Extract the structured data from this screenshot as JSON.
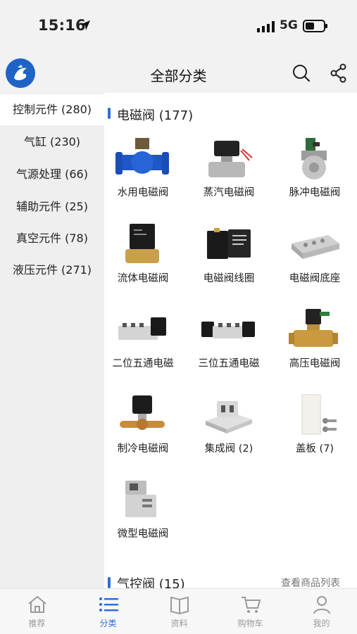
{
  "status_bar": {
    "time": "15:16",
    "network": "5G"
  },
  "header": {
    "title": "全部分类"
  },
  "sidebar": {
    "items": [
      {
        "label": "控制元件 (280)",
        "active": true
      },
      {
        "label": "气缸 (230)",
        "active": false
      },
      {
        "label": "气源处理 (66)",
        "active": false
      },
      {
        "label": "辅助元件 (25)",
        "active": false
      },
      {
        "label": "真空元件 (78)",
        "active": false
      },
      {
        "label": "液压元件 (271)",
        "active": false
      }
    ]
  },
  "main": {
    "sections": [
      {
        "title": "电磁阀 (177)",
        "items": [
          {
            "label": "水用电磁阀",
            "icon": "water-solenoid-valve-icon"
          },
          {
            "label": "蒸汽电磁阀",
            "icon": "steam-solenoid-valve-icon"
          },
          {
            "label": "脉冲电磁阀",
            "icon": "pulse-solenoid-valve-icon"
          },
          {
            "label": "流体电磁阀",
            "icon": "fluid-solenoid-valve-icon"
          },
          {
            "label": "电磁阀线圈",
            "icon": "solenoid-coil-icon"
          },
          {
            "label": "电磁阀底座",
            "icon": "valve-base-icon"
          },
          {
            "label": "二位五通电磁",
            "icon": "two-position-valve-icon"
          },
          {
            "label": "三位五通电磁",
            "icon": "three-position-valve-icon"
          },
          {
            "label": "高压电磁阀",
            "icon": "high-pressure-valve-icon"
          },
          {
            "label": "制冷电磁阀",
            "icon": "refrigeration-valve-icon"
          },
          {
            "label": "集成阀 (2)",
            "icon": "integrated-valve-icon"
          },
          {
            "label": "盖板 (7)",
            "icon": "cover-plate-icon"
          },
          {
            "label": "微型电磁阀",
            "icon": "micro-solenoid-valve-icon"
          }
        ]
      },
      {
        "title": "气控阀 (15)",
        "link": "查看商品列表"
      }
    ]
  },
  "tabbar": {
    "items": [
      {
        "label": "推荐",
        "icon": "home-icon",
        "active": false
      },
      {
        "label": "分类",
        "icon": "list-icon",
        "active": true
      },
      {
        "label": "资料",
        "icon": "book-icon",
        "active": false
      },
      {
        "label": "购物车",
        "icon": "cart-icon",
        "active": false
      },
      {
        "label": "我的",
        "icon": "user-icon",
        "active": false
      }
    ]
  },
  "colors": {
    "accent": "#2f6fd6",
    "sidebar_bg": "#efefef",
    "logo_blue": "#1f63c6"
  }
}
